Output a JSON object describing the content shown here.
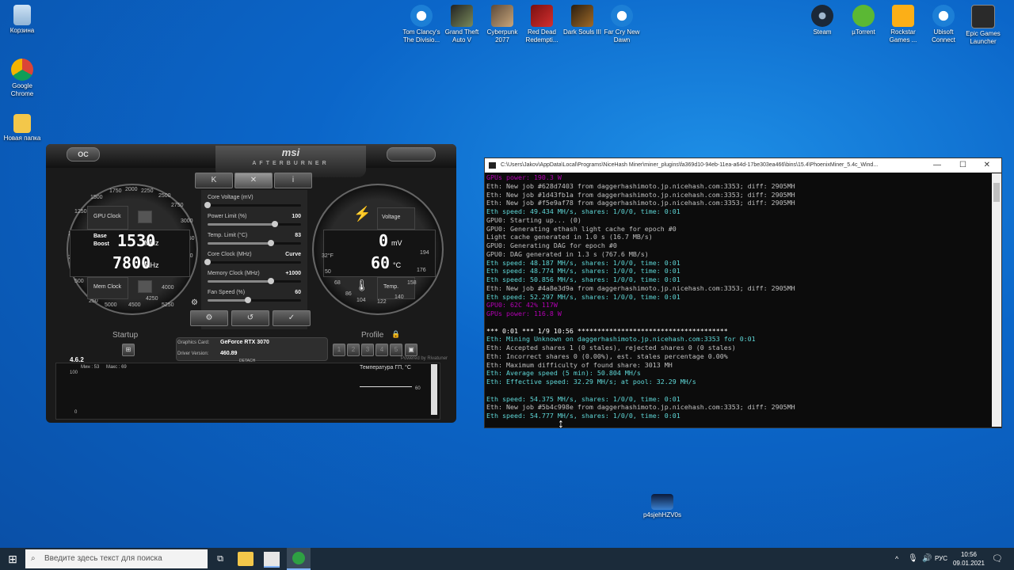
{
  "desktop": {
    "left_icons": [
      {
        "label": "Корзина",
        "icon": "recycle-bin-icon"
      },
      {
        "label": "Google Chrome",
        "icon": "chrome-icon"
      },
      {
        "label": "Новая папка",
        "icon": "folder-icon"
      }
    ],
    "top_icons": [
      {
        "label": "Tom Clancy's The Divisio...",
        "icon": "ubisoft-icon"
      },
      {
        "label": "Grand Theft Auto V",
        "icon": "gta-icon"
      },
      {
        "label": "Cyberpunk 2077",
        "icon": "cyberpunk-icon"
      },
      {
        "label": "Red Dead Redempti...",
        "icon": "rdr-icon"
      },
      {
        "label": "Dark Souls III",
        "icon": "darksouls-icon"
      },
      {
        "label": "Far Cry New Dawn",
        "icon": "ubisoft-icon"
      }
    ],
    "right_icons": [
      {
        "label": "Steam",
        "icon": "steam-icon"
      },
      {
        "label": "µTorrent",
        "icon": "utorrent-icon"
      },
      {
        "label": "Rockstar Games ...",
        "icon": "rockstar-icon"
      },
      {
        "label": "Ubisoft Connect",
        "icon": "ubisoft-icon"
      },
      {
        "label": "Epic Games Launcher",
        "icon": "epic-icon"
      }
    ],
    "bottom_icon": {
      "label": "p4sjehHZV0s",
      "icon": "video-file-icon"
    }
  },
  "afterburner": {
    "brand": "msi",
    "sub": "AFTERBURNER",
    "oc_label": "OC",
    "tabs": [
      "K",
      "✕",
      "i"
    ],
    "gpu_clock_label": "GPU Clock",
    "base_label": "Base",
    "boost_label": "Boost",
    "base_value": "1530",
    "boost_value": "7800",
    "mhz": "MHz",
    "mem_clock_label": "Mem Clock",
    "voltage_label": "Voltage",
    "voltage_value": "0",
    "mv": "mV",
    "temp_value": "60",
    "temp_unit": "°C",
    "temp_label": "Temp.",
    "left_ticks": [
      "250",
      "500",
      "750",
      "1000",
      "1250",
      "1500",
      "1750",
      "2000",
      "2250",
      "2500",
      "2750",
      "3000",
      "3250",
      "3500",
      "3750",
      "4000",
      "4250",
      "4500",
      "5000",
      "5250"
    ],
    "right_ticks": [
      "32°F",
      "50",
      "68",
      "86",
      "104",
      "122",
      "140",
      "158",
      "176",
      "194"
    ],
    "sliders": [
      {
        "label": "Core Voltage (mV)",
        "value": ""
      },
      {
        "label": "Power Limit (%)",
        "value": "100"
      },
      {
        "label": "Temp. Limit (°C)",
        "value": "83"
      },
      {
        "label": "Core Clock (MHz)",
        "value": "Curve"
      },
      {
        "label": "Memory Clock (MHz)",
        "value": "+1000"
      },
      {
        "label": "Fan Speed (%)",
        "value": "60"
      }
    ],
    "slider_levels": [
      0,
      0.72,
      0.68,
      0,
      0.68,
      0.43
    ],
    "startup_label": "Startup",
    "profile_label": "Profile",
    "profile_slots": [
      "1",
      "2",
      "3",
      "4",
      "5"
    ],
    "graphics_card_label": "Graphics Card:",
    "graphics_card_value": "GeForce RTX 3070",
    "driver_label": "Driver Version:",
    "driver_value": "460.89",
    "detach": "DETACH",
    "version": "4.6.2",
    "powered_by": "Powered by Rivatuner",
    "monitor": {
      "min_label": "Мин : 53",
      "max_label": "Макс : 69",
      "title": "Температура ГП, °С",
      "y_top": "100",
      "y_bottom": "0",
      "current": "60"
    }
  },
  "console": {
    "title": "C:\\Users\\Jakov\\AppData\\Local\\Programs\\NiceHash Miner\\miner_plugins\\fa369d10-94eb-11ea-a64d-17be303ea466\\bins\\15.4\\PhoenixMiner_5.4c_Wind...",
    "lines": [
      {
        "text": "GPUs power: 190.3 W",
        "color": "#b400b4"
      },
      {
        "text": "Eth: New job #628d7403 from daggerhashimoto.jp.nicehash.com:3353; diff: 2905MH",
        "color": "#c0c0c0"
      },
      {
        "text": "Eth: New job #1d43fb1a from daggerhashimoto.jp.nicehash.com:3353; diff: 2905MH",
        "color": "#c0c0c0"
      },
      {
        "text": "Eth: New job #f5e9af78 from daggerhashimoto.jp.nicehash.com:3353; diff: 2905MH",
        "color": "#c0c0c0"
      },
      {
        "text": "Eth speed: 49.434 MH/s, shares: 1/0/0, time: 0:01",
        "color": "#5fd7d7"
      },
      {
        "text": "GPU0: Starting up... (0)",
        "color": "#c0c0c0"
      },
      {
        "text": "GPU0: Generating ethash light cache for epoch #0",
        "color": "#c0c0c0"
      },
      {
        "text": "Light cache generated in 1.0 s (16.7 MB/s)",
        "color": "#c0c0c0"
      },
      {
        "text": "GPU0: Generating DAG for epoch #0",
        "color": "#c0c0c0"
      },
      {
        "text": "GPU0: DAG generated in 1.3 s (767.6 MB/s)",
        "color": "#c0c0c0"
      },
      {
        "text": "Eth speed: 48.187 MH/s, shares: 1/0/0, time: 0:01",
        "color": "#5fd7d7"
      },
      {
        "text": "Eth speed: 48.774 MH/s, shares: 1/0/0, time: 0:01",
        "color": "#5fd7d7"
      },
      {
        "text": "Eth speed: 50.856 MH/s, shares: 1/0/0, time: 0:01",
        "color": "#5fd7d7"
      },
      {
        "text": "Eth: New job #4a8e3d9a from daggerhashimoto.jp.nicehash.com:3353; diff: 2905MH",
        "color": "#c0c0c0"
      },
      {
        "text": "Eth speed: 52.297 MH/s, shares: 1/0/0, time: 0:01",
        "color": "#5fd7d7"
      },
      {
        "text": "GPU0: 62C 42% 117W",
        "color": "#b400b4"
      },
      {
        "text": "GPUs power: 116.8 W",
        "color": "#b400b4"
      },
      {
        "text": "",
        "color": "#c0c0c0"
      },
      {
        "text": "*** 0:01 *** 1/9 10:56 **************************************",
        "color": "#ffffff"
      },
      {
        "text": "Eth: Mining Unknown on daggerhashimoto.jp.nicehash.com:3353 for 0:01",
        "color": "#5fd7d7"
      },
      {
        "text": "Eth: Accepted shares 1 (0 stales), rejected shares 0 (0 stales)",
        "color": "#c0c0c0"
      },
      {
        "text": "Eth: Incorrect shares 0 (0.00%), est. stales percentage 0.00%",
        "color": "#c0c0c0"
      },
      {
        "text": "Eth: Maximum difficulty of found share: 3013 MH",
        "color": "#c0c0c0"
      },
      {
        "text": "Eth: Average speed (5 min): 50.804 MH/s",
        "color": "#5fd7d7"
      },
      {
        "text": "Eth: Effective speed: 32.29 MH/s; at pool: 32.29 MH/s",
        "color": "#5fd7d7"
      },
      {
        "text": "",
        "color": "#c0c0c0"
      },
      {
        "text": "Eth speed: 54.375 MH/s, shares: 1/0/0, time: 0:01",
        "color": "#5fd7d7"
      },
      {
        "text": "Eth: New job #5b4c998e from daggerhashimoto.jp.nicehash.com:3353; diff: 2905MH",
        "color": "#c0c0c0"
      },
      {
        "text": "Eth speed: 54.777 MH/s, shares: 1/0/0, time: 0:01",
        "color": "#5fd7d7"
      }
    ]
  },
  "taskbar": {
    "search_placeholder": "Введите здесь текст для поиска",
    "lang": "РУС",
    "time": "10:56",
    "date": "09.01.2021"
  }
}
